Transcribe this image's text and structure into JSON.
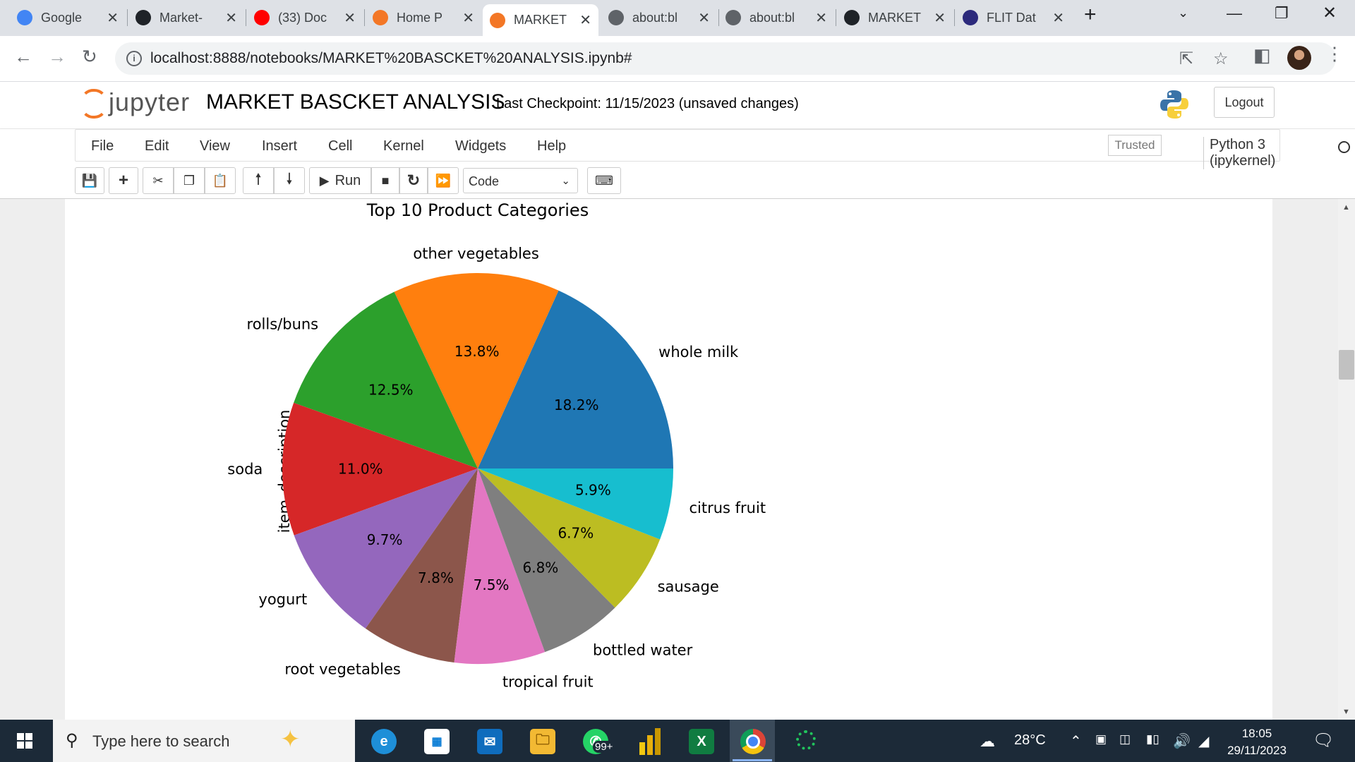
{
  "browser": {
    "tabs": [
      {
        "title": "Google",
        "icon": "google-icon",
        "color": "#4285f4"
      },
      {
        "title": "Market-",
        "icon": "github-icon",
        "color": "#1f2328"
      },
      {
        "title": "(33) Doc",
        "icon": "youtube-icon",
        "color": "#ff0000"
      },
      {
        "title": "Home P",
        "icon": "loading-icon",
        "color": "#f37726"
      },
      {
        "title": "MARKET",
        "icon": "jupyter-icon",
        "color": "#f37726"
      },
      {
        "title": "about:bl",
        "icon": "globe-icon",
        "color": "#5f6368"
      },
      {
        "title": "about:bl",
        "icon": "globe-icon",
        "color": "#5f6368"
      },
      {
        "title": "MARKET",
        "icon": "github-icon",
        "color": "#1f2328"
      },
      {
        "title": "FLIT Dat",
        "icon": "flit-icon",
        "color": "#2c2a7c"
      }
    ],
    "active_tab": 4,
    "url": "localhost:8888/notebooks/MARKET%20BASCKET%20ANALYSIS.ipynb#"
  },
  "jupyter": {
    "brand": "jupyter",
    "notebook_title": "MARKET BASCKET ANALYSIS",
    "checkpoint": "Last Checkpoint: 11/15/2023   (unsaved changes)",
    "logout_label": "Logout",
    "menu": [
      "File",
      "Edit",
      "View",
      "Insert",
      "Cell",
      "Kernel",
      "Widgets",
      "Help"
    ],
    "trusted_label": "Trusted",
    "kernel_label": "Python 3 (ipykernel)",
    "run_label": "Run",
    "cell_type": "Code"
  },
  "chart_data": {
    "type": "pie",
    "title": "Top 10 Product Categories",
    "ylabel": "item_description",
    "start_angle_deg": 0,
    "direction": "counterclockwise",
    "slices": [
      {
        "label": "whole milk",
        "pct": 18.2,
        "pct_label": "18.2%",
        "color": "#1f77b4"
      },
      {
        "label": "other vegetables",
        "pct": 13.8,
        "pct_label": "13.8%",
        "color": "#ff7f0e"
      },
      {
        "label": "rolls/buns",
        "pct": 12.5,
        "pct_label": "12.5%",
        "color": "#2ca02c"
      },
      {
        "label": "soda",
        "pct": 11.0,
        "pct_label": "11.0%",
        "color": "#d62728"
      },
      {
        "label": "yogurt",
        "pct": 9.7,
        "pct_label": "9.7%",
        "color": "#9467bd"
      },
      {
        "label": "root vegetables",
        "pct": 7.8,
        "pct_label": "7.8%",
        "color": "#8c564b"
      },
      {
        "label": "tropical fruit",
        "pct": 7.5,
        "pct_label": "7.5%",
        "color": "#e377c2"
      },
      {
        "label": "bottled water",
        "pct": 6.8,
        "pct_label": "6.8%",
        "color": "#7f7f7f"
      },
      {
        "label": "sausage",
        "pct": 6.7,
        "pct_label": "6.7%",
        "color": "#bcbd22"
      },
      {
        "label": "citrus fruit",
        "pct": 5.9,
        "pct_label": "5.9%",
        "color": "#17becf"
      }
    ]
  },
  "taskbar": {
    "search_placeholder": "Type here to search",
    "whatsapp_badge": "99+",
    "temperature": "28°C",
    "time": "18:05",
    "date": "29/11/2023"
  }
}
